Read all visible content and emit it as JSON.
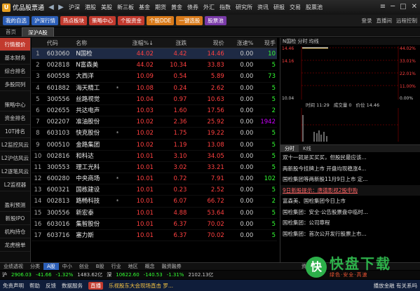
{
  "window": {
    "title": "优品股票通",
    "logo": "U"
  },
  "menu": [
    "沪深",
    "港股",
    "美股",
    "新三板",
    "基金",
    "期货",
    "黄金",
    "债券",
    "外汇",
    "指数",
    "研究所",
    "资讯",
    "研报",
    "交易",
    "股票池"
  ],
  "toolbar": {
    "buttons": [
      {
        "label": "我的自选",
        "color": "blue"
      },
      {
        "label": "沪深行情",
        "color": "blue"
      },
      {
        "label": "热点板块",
        "color": "red"
      },
      {
        "label": "策略中心",
        "color": "red"
      },
      {
        "label": "个股资金",
        "color": "red"
      },
      {
        "label": "个股DDE",
        "color": "orange"
      },
      {
        "label": "一键选股",
        "color": "orange"
      },
      {
        "label": "股票池",
        "color": "purple"
      }
    ],
    "right": [
      "登录",
      "直播间",
      "远程控制"
    ]
  },
  "tabs": [
    {
      "label": "首页"
    },
    {
      "label": "深沪A股"
    }
  ],
  "sidebar": {
    "items": [
      "行情报价",
      "基本财务",
      "综合排名",
      "多股同列",
      "策略中心",
      "资金排名",
      "10T排名",
      "L2监控风云",
      "L2沪估风云",
      "L2逐笔风云",
      "L2监视器",
      "盈利预测",
      "新股IPO",
      "机构持仓",
      "龙虎榜单"
    ],
    "bottom": "业绩透视"
  },
  "table": {
    "headers": {
      "code": "代码",
      "name": "名称",
      "pct": "涨幅%↓",
      "chg": "涨跌",
      "price": "现价",
      "speed": "涨速%",
      "vol": "现手"
    },
    "rows": [
      {
        "idx": "1",
        "code": "603060",
        "name": "N国检",
        "flag": "",
        "pct": "44.02",
        "chg": "4.42",
        "price": "14.46",
        "speed": "0.00",
        "vol": "10"
      },
      {
        "idx": "2",
        "code": "002818",
        "name": "N富森美",
        "flag": "",
        "pct": "44.02",
        "chg": "10.34",
        "price": "33.83",
        "speed": "0.00",
        "vol": "5"
      },
      {
        "idx": "3",
        "code": "600558",
        "name": "大西洋",
        "flag": "",
        "pct": "10.09",
        "chg": "0.54",
        "price": "5.89",
        "speed": "0.00",
        "vol": "73"
      },
      {
        "idx": "4",
        "code": "601882",
        "name": "海天精工",
        "flag": "*",
        "pct": "10.08",
        "chg": "0.24",
        "price": "2.62",
        "speed": "0.00",
        "vol": "5"
      },
      {
        "idx": "5",
        "code": "300556",
        "name": "丝路视觉",
        "flag": "",
        "pct": "10.04",
        "chg": "0.97",
        "price": "10.63",
        "speed": "0.00",
        "vol": "5"
      },
      {
        "idx": "6",
        "code": "002655",
        "name": "共达电声",
        "flag": "",
        "pct": "10.03",
        "chg": "1.60",
        "price": "17.56",
        "speed": "0.00",
        "vol": "2"
      },
      {
        "idx": "7",
        "code": "002207",
        "name": "准油股份",
        "flag": "",
        "pct": "10.02",
        "chg": "2.36",
        "price": "25.92",
        "speed": "0.00",
        "vol": "1942"
      },
      {
        "idx": "8",
        "code": "603103",
        "name": "快克股份",
        "flag": "*",
        "pct": "10.02",
        "chg": "1.75",
        "price": "19.22",
        "speed": "0.00",
        "vol": "5"
      },
      {
        "idx": "9",
        "code": "000510",
        "name": "金路集团",
        "flag": "",
        "pct": "10.02",
        "chg": "1.19",
        "price": "13.08",
        "speed": "0.00",
        "vol": "5"
      },
      {
        "idx": "10",
        "code": "002816",
        "name": "和科达",
        "flag": "",
        "pct": "10.01",
        "chg": "3.10",
        "price": "34.05",
        "speed": "0.00",
        "vol": "5"
      },
      {
        "idx": "11",
        "code": "300553",
        "name": "理工光科",
        "flag": "",
        "pct": "10.01",
        "chg": "3.02",
        "price": "33.21",
        "speed": "0.00",
        "vol": "5"
      },
      {
        "idx": "12",
        "code": "600280",
        "name": "中央商场",
        "flag": "*",
        "pct": "10.01",
        "chg": "0.72",
        "price": "7.91",
        "speed": "0.00",
        "vol": "102"
      },
      {
        "idx": "13",
        "code": "600321",
        "name": "国栋建设",
        "flag": "",
        "pct": "10.01",
        "chg": "0.23",
        "price": "2.52",
        "speed": "0.00",
        "vol": "5"
      },
      {
        "idx": "14",
        "code": "002813",
        "name": "路畅科技",
        "flag": "*",
        "pct": "10.01",
        "chg": "6.07",
        "price": "66.72",
        "speed": "0.00",
        "vol": "2"
      },
      {
        "idx": "15",
        "code": "300556",
        "name": "新宏泰",
        "flag": "",
        "pct": "10.01",
        "chg": "4.88",
        "price": "53.64",
        "speed": "0.00",
        "vol": "5"
      },
      {
        "idx": "16",
        "code": "603016",
        "name": "集智股份",
        "flag": "",
        "pct": "10.01",
        "chg": "6.37",
        "price": "70.02",
        "speed": "0.00",
        "vol": "5"
      },
      {
        "idx": "17",
        "code": "603716",
        "name": "塞力斯",
        "flag": "",
        "pct": "10.01",
        "chg": "6.37",
        "price": "70.02",
        "speed": "0.00",
        "vol": "5"
      }
    ]
  },
  "minichart": {
    "title": "N国检  分时  均线",
    "left_labels": [
      "14.46",
      "14.16",
      "",
      "",
      "10.04"
    ],
    "right_labels": [
      "44.02%",
      "33.01%",
      "22.01%",
      "11.00%",
      "0.00%"
    ],
    "info": {
      "time": "时间 11:29",
      "volume": "成交量 0",
      "price": "价位 14.46"
    },
    "color_up": "#ff4040",
    "color_avg": "#f5c342"
  },
  "news": {
    "tabs": [
      "分时",
      "K线"
    ],
    "items": [
      "双十一就是买买买，但股民最应该...",
      "两新股今挂牌上市 开盘均现稳涨4...",
      "国检集团等两新股11月9日上市 定...",
      "9日新股提示：唐德影视2股申购",
      "富森美、国检集团今日上市",
      "国检集团：安全·公告股票盘中临时...",
      "国检集团：公司章程",
      "国检集团：首次公开发行股票上市..."
    ],
    "highlight_index": 3,
    "panel_label": "资讯"
  },
  "bottom_tabs": [
    "分类",
    "A股",
    "中小",
    "创业",
    "B股",
    "行业",
    "地区",
    "概念",
    "融资融券"
  ],
  "index_bar": [
    {
      "name": "沪",
      "value": "2906.03",
      "chg": "-41.66",
      "pct": "-1.32%",
      "amount": "1483.62亿",
      "tone": "g"
    },
    {
      "name": "深",
      "value": "10622.60",
      "chg": "-140.53",
      "pct": "-1.31%",
      "amount": "2102.13亿",
      "tone": "g"
    }
  ],
  "statusbar": {
    "items": [
      "免责声明",
      "帮助",
      "反馈",
      "数据服务"
    ],
    "live": "直播",
    "ticker": "乐视股东大会现场直击 罗...",
    "right": "播放金融 有关系吗"
  },
  "watermark": {
    "logo": "快",
    "title": "快盘下载",
    "sub": "绿色·安全·高速"
  }
}
